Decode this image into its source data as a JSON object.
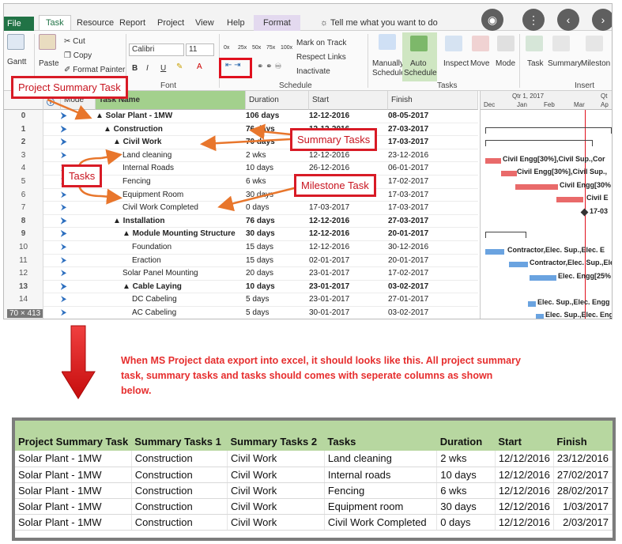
{
  "ribbon": {
    "file_tab": "File",
    "tabs": [
      "Task",
      "Resource",
      "Report",
      "Project",
      "View",
      "Help"
    ],
    "format_tab": "Format",
    "tell_me": "Tell me what you want to do",
    "gantt_label": "Gantt",
    "clipboard": {
      "paste": "Paste",
      "cut": "Cut",
      "copy": "Copy",
      "format_painter": "Format Painter"
    },
    "font": {
      "name": "Calibri",
      "size": "11",
      "group": "Font"
    },
    "schedule": {
      "mark_on_track": "Mark on Track",
      "respect_links": "Respect Links",
      "inactivate": "Inactivate",
      "group": "Schedule",
      "pct": [
        "0x",
        "25x",
        "50x",
        "75x",
        "100x"
      ]
    },
    "tasks": {
      "manually_line1": "Manually",
      "manually_line2": "Schedule",
      "auto_line1": "Auto",
      "auto_line2": "Schedule",
      "inspect": "Inspect",
      "move": "Move",
      "mode": "Mode",
      "group": "Tasks"
    },
    "insert": {
      "task": "Task",
      "summary": "Summary",
      "milestone": "Mileston",
      "group": "Insert"
    }
  },
  "grid": {
    "headers": {
      "mode": "Mode",
      "name": "Task Name",
      "duration": "Duration",
      "start": "Start",
      "finish": "Finish"
    },
    "rows": [
      {
        "id": "0",
        "name": "▲ Solar Plant - 1MW",
        "duration": "106 days",
        "start": "12-12-2016",
        "finish": "08-05-2017"
      },
      {
        "id": "1",
        "name": "▲ Construction",
        "duration": "76 days",
        "start": "12-12-2016",
        "finish": "27-03-2017"
      },
      {
        "id": "2",
        "name": "▲ Civil Work",
        "duration": "70 days",
        "start": "12-12-2016",
        "finish": "17-03-2017"
      },
      {
        "id": "3",
        "name": "Land cleaning",
        "duration": "2 wks",
        "start": "12-12-2016",
        "finish": "23-12-2016"
      },
      {
        "id": "4",
        "name": "Internal Roads",
        "duration": "10 days",
        "start": "26-12-2016",
        "finish": "06-01-2017"
      },
      {
        "id": "5",
        "name": "Fencing",
        "duration": "6 wks",
        "start": "12-12-2016",
        "finish": "17-02-2017"
      },
      {
        "id": "6",
        "name": "Equipment Room",
        "duration": "30 days",
        "start": "06-02-2017",
        "finish": "17-03-2017"
      },
      {
        "id": "7",
        "name": "Civil Work Completed",
        "duration": "0 days",
        "start": "17-03-2017",
        "finish": "17-03-2017"
      },
      {
        "id": "8",
        "name": "▲ Installation",
        "duration": "76 days",
        "start": "12-12-2016",
        "finish": "27-03-2017"
      },
      {
        "id": "9",
        "name": "▲ Module Mounting Structure",
        "duration": "30 days",
        "start": "12-12-2016",
        "finish": "20-01-2017"
      },
      {
        "id": "10",
        "name": "Foundation",
        "duration": "15 days",
        "start": "12-12-2016",
        "finish": "30-12-2016"
      },
      {
        "id": "11",
        "name": "Eraction",
        "duration": "15 days",
        "start": "02-01-2017",
        "finish": "20-01-2017"
      },
      {
        "id": "12",
        "name": "Solar Panel Mounting",
        "duration": "20 days",
        "start": "23-01-2017",
        "finish": "17-02-2017"
      },
      {
        "id": "13",
        "name": "▲ Cable Laying",
        "duration": "10 days",
        "start": "23-01-2017",
        "finish": "03-02-2017"
      },
      {
        "id": "14",
        "name": "DC Cabeling",
        "duration": "5 days",
        "start": "23-01-2017",
        "finish": "27-01-2017"
      },
      {
        "id": "15",
        "name": "AC Cabeling",
        "duration": "5 days",
        "start": "30-01-2017",
        "finish": "03-02-2017"
      }
    ]
  },
  "gantt": {
    "qtr": "Qtr 1, 2017",
    "qtr2": "Qt",
    "months": [
      "Dec",
      "Jan",
      "Feb",
      "Mar",
      "Ap"
    ],
    "labels": [
      "Civil Engg[30%],Civil Sup.,Cor",
      "Civil Engg[30%],Civil Sup.,",
      "Civil Engg[30%",
      "Civil E",
      "17-03",
      "Contractor,Elec. Sup.,Elec. E",
      "Contractor,Elec. Sup.,Ele",
      "Elec. Engg[25%",
      "Elec. Sup.,Elec. Engg",
      "Elec. Sup.,Elec. Engg"
    ]
  },
  "dim_tag": "70 × 413",
  "callouts": {
    "project_summary": "Project Summary Task",
    "summary_tasks": "Summary Tasks",
    "tasks": "Tasks",
    "milestone": "Milestone Task"
  },
  "note": "When MS Project data export into excel, it should looks like this. All project summary task, summary tasks and tasks should comes with seperate columns as shown below.",
  "excel": {
    "headers": [
      "Project Summary Task",
      "Summary Tasks 1",
      "Summary Tasks 2",
      "Tasks",
      "Duration",
      "Start",
      "Finish"
    ],
    "rows": [
      [
        "Solar Plant - 1MW",
        "Construction",
        "Civil Work",
        "Land cleaning",
        "2 wks",
        "12/12/2016",
        "23/12/2016"
      ],
      [
        "Solar Plant - 1MW",
        "Construction",
        "Civil Work",
        "Internal roads",
        "10 days",
        "12/12/2016",
        "27/02/2017"
      ],
      [
        "Solar Plant - 1MW",
        "Construction",
        "Civil Work",
        "Fencing",
        "6 wks",
        "12/12/2016",
        "28/02/2017"
      ],
      [
        "Solar Plant - 1MW",
        "Construction",
        "Civil Work",
        "Equipment room",
        "30 days",
        "12/12/2016",
        "1/03/2017"
      ],
      [
        "Solar Plant - 1MW",
        "Construction",
        "Civil Work",
        "Civil Work Completed",
        "0 days",
        "12/12/2016",
        "2/03/2017"
      ]
    ]
  },
  "colors": {
    "excel_green": "#217346",
    "header_green": "#a3d08d",
    "annotation_red": "#d81b26",
    "task_bar": "#e96a6a",
    "install_bar": "#6aa3e0"
  }
}
